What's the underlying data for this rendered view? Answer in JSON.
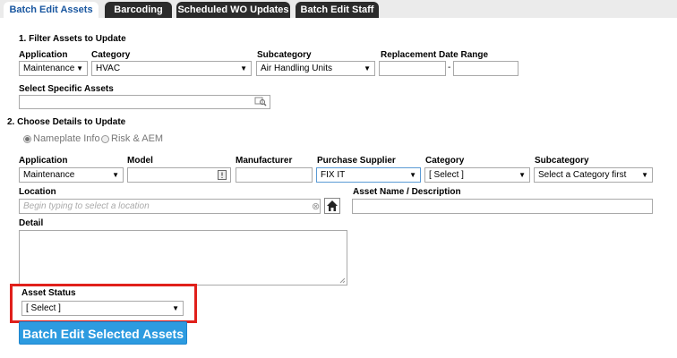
{
  "tabs": [
    "Batch Edit Assets",
    "Barcoding",
    "Scheduled WO Updates",
    "Batch Edit Staff"
  ],
  "filter": {
    "section_title": "1. Filter Assets to Update",
    "application_label": "Application",
    "application_value": "Maintenance",
    "category_label": "Category",
    "category_value": "HVAC",
    "subcategory_label": "Subcategory",
    "subcategory_value": "Air Handling Units",
    "date_range_label": "Replacement Date Range",
    "date_separator": "-",
    "specific_assets_label": "Select Specific Assets"
  },
  "details": {
    "section_title": "2. Choose Details to Update",
    "radio_nameplate": "Nameplate Info",
    "radio_risk": "Risk & AEM",
    "application_label": "Application",
    "application_value": "Maintenance",
    "model_label": "Model",
    "manufacturer_label": "Manufacturer",
    "supplier_label": "Purchase Supplier",
    "supplier_value": "FIX IT",
    "category_label": "Category",
    "category_value": "[ Select ]",
    "subcategory_label": "Subcategory",
    "subcategory_value": "Select a Category first",
    "location_label": "Location",
    "location_placeholder": "Begin typing to select a location",
    "asset_name_label": "Asset Name / Description",
    "detail_label": "Detail",
    "status_label": "Asset Status",
    "status_value": "[ Select ]"
  },
  "submit_label": "Batch Edit Selected Assets",
  "colors": {
    "accent": "#2d9be0",
    "tab_active_text": "#1a57a0",
    "highlight": "#e0201b"
  }
}
